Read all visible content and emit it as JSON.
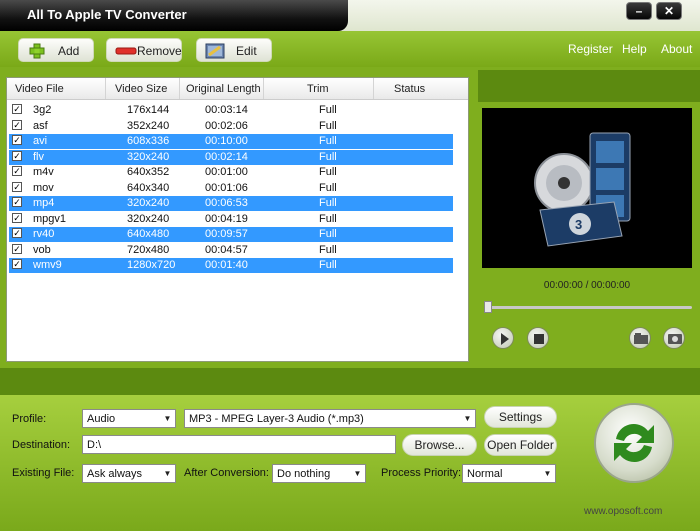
{
  "app": {
    "title": "All To Apple TV Converter"
  },
  "window": {
    "minimize": "–",
    "close": "✕"
  },
  "toolbar": {
    "add": "Add",
    "remove": "Remove",
    "edit": "Edit",
    "register": "Register",
    "help": "Help",
    "about": "About"
  },
  "list": {
    "headers": [
      "Video File",
      "Video Size",
      "Original Length",
      "Trim",
      "Status"
    ],
    "rows": [
      {
        "file": "3g2",
        "size": "176x144",
        "length": "00:03:14",
        "trim": "Full",
        "status": "",
        "selected": false
      },
      {
        "file": "asf",
        "size": "352x240",
        "length": "00:02:06",
        "trim": "Full",
        "status": "",
        "selected": false
      },
      {
        "file": "avi",
        "size": "608x336",
        "length": "00:10:00",
        "trim": "Full",
        "status": "",
        "selected": true
      },
      {
        "file": "flv",
        "size": "320x240",
        "length": "00:02:14",
        "trim": "Full",
        "status": "",
        "selected": true
      },
      {
        "file": "m4v",
        "size": "640x352",
        "length": "00:01:00",
        "trim": "Full",
        "status": "",
        "selected": false
      },
      {
        "file": "mov",
        "size": "640x340",
        "length": "00:01:06",
        "trim": "Full",
        "status": "",
        "selected": false
      },
      {
        "file": "mp4",
        "size": "320x240",
        "length": "00:06:53",
        "trim": "Full",
        "status": "",
        "selected": true
      },
      {
        "file": "mpgv1",
        "size": "320x240",
        "length": "00:04:19",
        "trim": "Full",
        "status": "",
        "selected": false
      },
      {
        "file": "rv40",
        "size": "640x480",
        "length": "00:09:57",
        "trim": "Full",
        "status": "",
        "selected": true
      },
      {
        "file": "vob",
        "size": "720x480",
        "length": "00:04:57",
        "trim": "Full",
        "status": "",
        "selected": false
      },
      {
        "file": "wmv9",
        "size": "1280x720",
        "length": "00:01:40",
        "trim": "Full",
        "status": "",
        "selected": true
      }
    ]
  },
  "player": {
    "time": "00:00:00 / 00:00:00",
    "progress": 0
  },
  "settings": {
    "profile_label": "Profile:",
    "profile_category": "Audio",
    "profile_format": "MP3 - MPEG Layer-3 Audio (*.mp3)",
    "settings_button": "Settings",
    "destination_label": "Destination:",
    "destination_value": "D:\\",
    "browse_button": "Browse...",
    "open_folder_button": "Open Folder",
    "existing_file_label": "Existing File:",
    "existing_file_value": "Ask always",
    "after_conversion_label": "After Conversion:",
    "after_conversion_value": "Do nothing",
    "process_priority_label": "Process Priority:",
    "process_priority_value": "Normal"
  },
  "watermark": {
    "text": "www.oposoft.com"
  },
  "colors": {
    "accent_green": "#7fae1e",
    "selection_blue": "#3399ff",
    "dark_panel": "#5c8a10"
  },
  "icons": [
    "add-icon",
    "remove-icon",
    "edit-icon",
    "play-icon",
    "stop-icon",
    "snapshot-folder-icon",
    "snapshot-icon",
    "convert-icon",
    "checkbox-icon"
  ]
}
